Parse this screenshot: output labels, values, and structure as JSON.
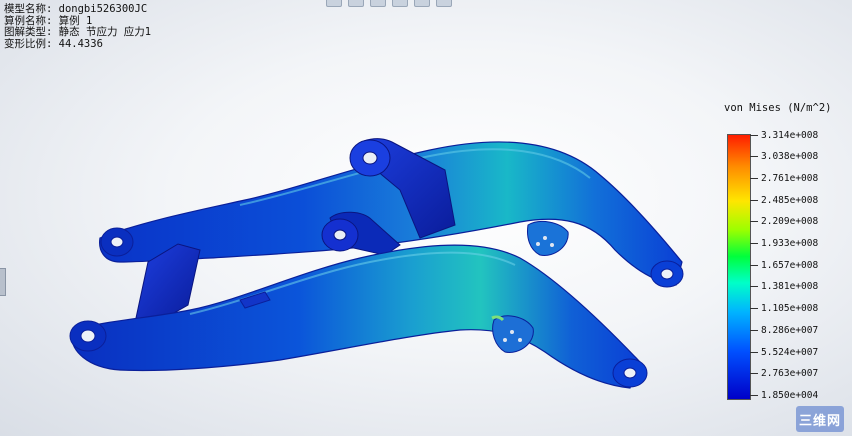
{
  "info": {
    "model_name": "模型名称: dongbi526300JC",
    "study_name": "算例名称: 算例 1",
    "plot_type": "图解类型: 静态 节应力 应力1",
    "deformation_scale": "变形比例: 44.4336"
  },
  "toolbar": {
    "icons": [
      "zoom-fit-icon",
      "zoom-area-icon",
      "view-orientation-icon",
      "display-style-icon",
      "section-view-icon",
      "appearance-icon"
    ]
  },
  "legend": {
    "title": "von Mises (N/m^2)",
    "ticks": [
      "3.314e+008",
      "3.038e+008",
      "2.761e+008",
      "2.485e+008",
      "2.209e+008",
      "1.933e+008",
      "1.657e+008",
      "1.381e+008",
      "1.105e+008",
      "8.286e+007",
      "5.524e+007",
      "2.763e+007",
      "1.850e+004"
    ],
    "colors": [
      "#ff1e00",
      "#ff8c00",
      "#ffe600",
      "#9bff00",
      "#00ff3c",
      "#00ffc8",
      "#00b4ff",
      "#0050ff",
      "#0000c8"
    ]
  },
  "watermark": {
    "text": "三维网"
  },
  "model": {
    "colors": {
      "main": "#0a3fd6",
      "dark": "#0a1f9a",
      "light": "#19b8c8",
      "hot": "#7ee07a"
    }
  }
}
